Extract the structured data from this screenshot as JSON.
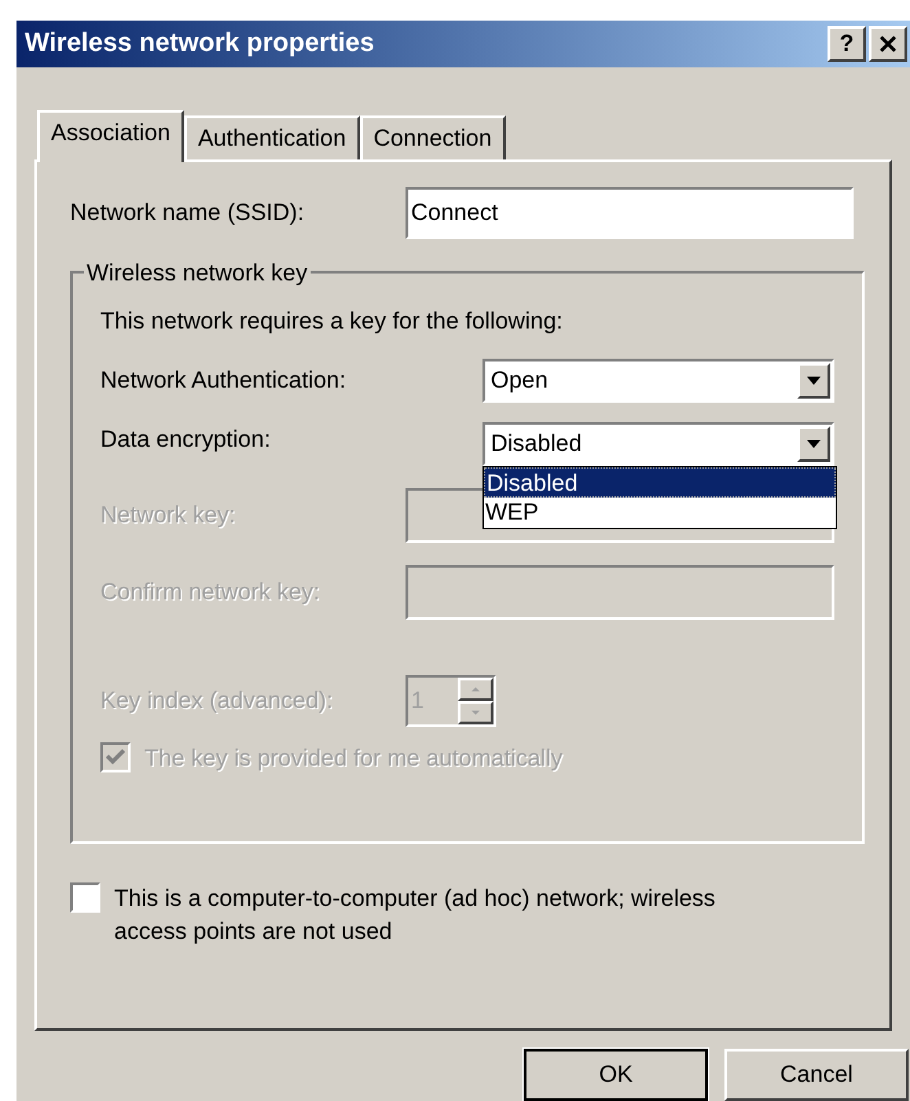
{
  "window": {
    "title": "Wireless network properties",
    "help_button": "?"
  },
  "tabs": [
    {
      "label": "Association",
      "selected": true
    },
    {
      "label": "Authentication",
      "selected": false
    },
    {
      "label": "Connection",
      "selected": false
    }
  ],
  "ssid": {
    "label": "Network name (SSID):",
    "value": "Connect"
  },
  "key_group": {
    "title": "Wireless network key",
    "intro": "This network requires a key for the following:",
    "authentication": {
      "label": "Network Authentication:",
      "value": "Open",
      "disabled": false
    },
    "encryption": {
      "label": "Data encryption:",
      "value": "Disabled",
      "disabled": false,
      "expanded": true,
      "options": [
        {
          "label": "Disabled",
          "selected": true
        },
        {
          "label": "WEP",
          "selected": false
        }
      ]
    },
    "network_key": {
      "label": "Network key:",
      "disabled": true
    },
    "confirm_key": {
      "label": "Confirm network key:",
      "disabled": true
    },
    "key_index": {
      "label": "Key index (advanced):",
      "value": "1",
      "disabled": true
    },
    "auto_key": {
      "label": "The key is provided for me automatically",
      "checked": true,
      "disabled": true
    }
  },
  "adhoc": {
    "label": "This is a computer-to-computer (ad hoc) network; wireless access points are not used",
    "checked": false,
    "disabled": false
  },
  "buttons": [
    {
      "label": "OK"
    },
    {
      "label": "Cancel"
    }
  ]
}
